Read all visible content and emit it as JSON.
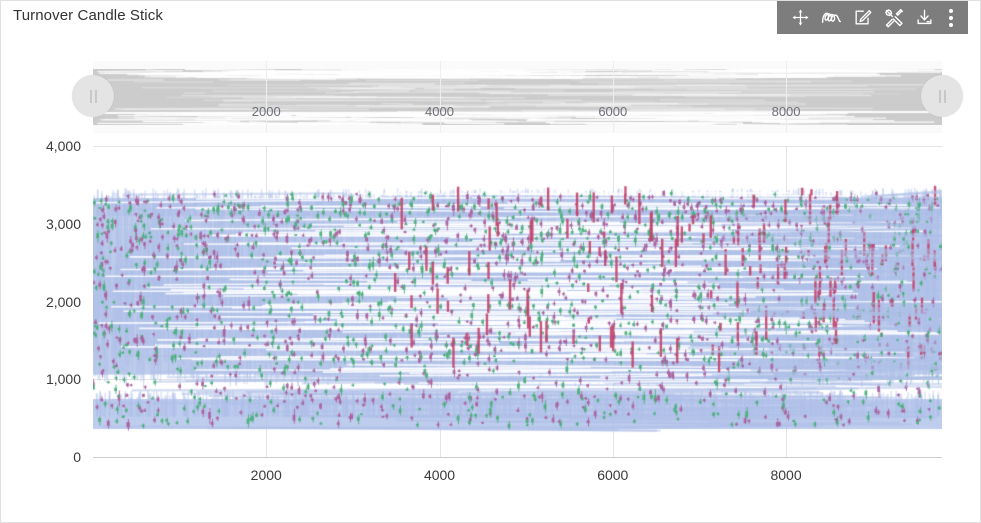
{
  "header": {
    "title": "Turnover Candle Stick"
  },
  "toolbox": {
    "background_color": "#7d7d7d",
    "icon_color": "#ffffff",
    "items": [
      {
        "name": "move-icon",
        "label": "Move / Pan"
      },
      {
        "name": "scribble-icon",
        "label": "Freehand Draw"
      },
      {
        "name": "edit-icon",
        "label": "Edit"
      },
      {
        "name": "tools-icon",
        "label": "Tools"
      },
      {
        "name": "download-icon",
        "label": "Download"
      },
      {
        "name": "more-icon",
        "label": "More Options"
      }
    ]
  },
  "datazoom": {
    "left_handle_label": "||",
    "right_handle_label": "||",
    "start_percent": 0,
    "end_percent": 100,
    "tick_labels": [
      "2000",
      "4000",
      "6000",
      "8000"
    ],
    "tick_values": [
      2000,
      4000,
      6000,
      8000
    ],
    "track_color": "#cccccc",
    "handle_color": "#e4e4e4"
  },
  "chart_data": {
    "type": "bar",
    "title": "Turnover Candle Stick",
    "subtitle": "",
    "xlabel": "",
    "ylabel": "",
    "x_tick_labels": [
      "2000",
      "4000",
      "6000",
      "8000"
    ],
    "x_tick_values": [
      2000,
      4000,
      6000,
      8000
    ],
    "y_tick_labels": [
      "0",
      "1,000",
      "2,000",
      "3,000",
      "4,000"
    ],
    "y_tick_values": [
      0,
      1000,
      2000,
      3000,
      4000
    ],
    "xlim": [
      0,
      9800
    ],
    "ylim": [
      0,
      4000
    ],
    "grid": true,
    "legend": "none",
    "series": [
      {
        "name": "Rising Candle",
        "color": "#4caf7d",
        "note": "green up-candles, dense across full x range, bodies mostly between 400 and 3400"
      },
      {
        "name": "Falling Candle",
        "color": "#a8639e",
        "note": "purple down-candles, dense across full x range, bodies mostly between 400 and 3400"
      },
      {
        "name": "Turnover Band",
        "color": "#aebfe8",
        "note": "light periwinkle high-low range mass forming two bands: a broad band ~1000-3400 and a lower band ~350-750"
      }
    ],
    "density_bands": [
      {
        "y_low": 1000,
        "y_high": 3400,
        "opacity": "dense"
      },
      {
        "y_low": 350,
        "y_high": 750,
        "opacity": "dense"
      },
      {
        "y_low": 750,
        "y_high": 1000,
        "opacity": "sparse"
      }
    ],
    "point_count_estimate": 9800
  },
  "colors": {
    "rising": "#4caf7d",
    "falling": "#a8639e",
    "band": "#aebfe8",
    "grid": "#e0e6f1",
    "axis": "#cccccc",
    "text": "#3a3a3a"
  }
}
